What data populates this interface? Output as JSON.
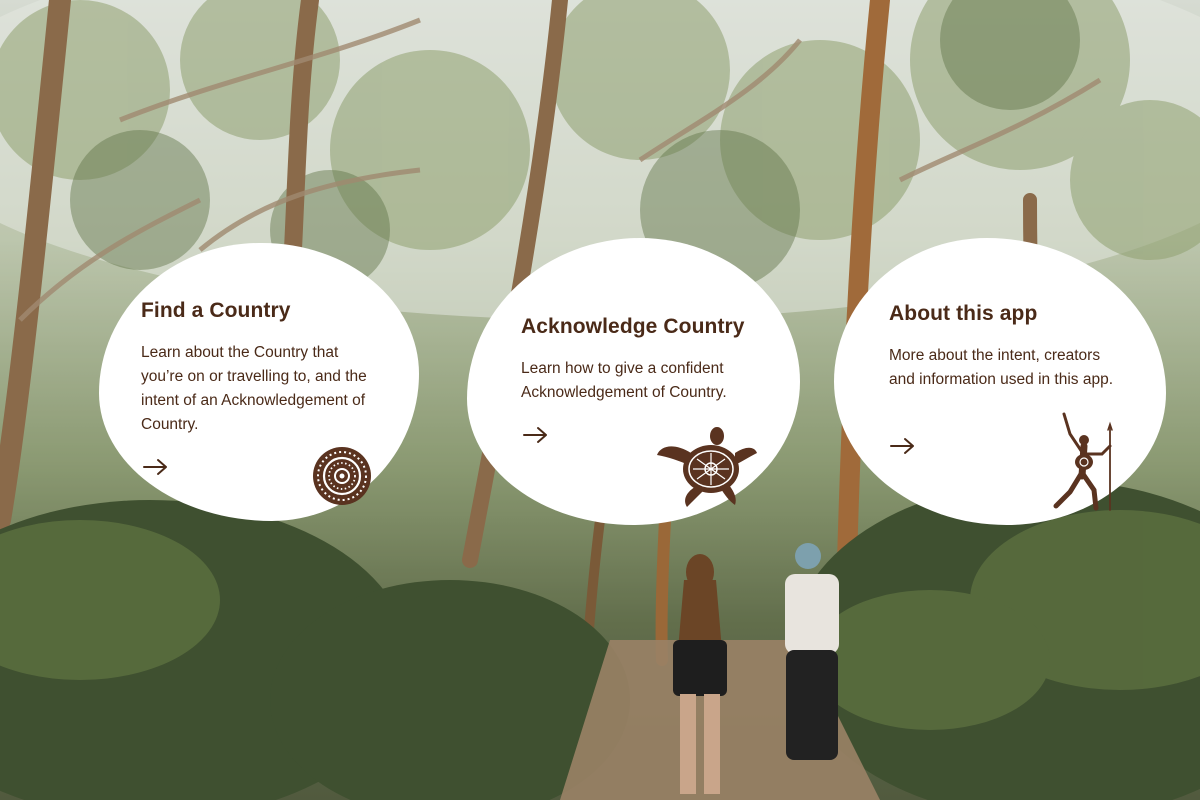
{
  "cards": [
    {
      "id": "find",
      "title": "Find a Country",
      "description": "Learn about the Country that you’re on or travelling to, and the intent of an Acknowledgement of Country.",
      "arrow_icon": "arrow-right-icon",
      "motif_icon": "concentric-circles-icon"
    },
    {
      "id": "ack",
      "title": "Acknowledge Country",
      "description": "Learn how to give a confident Acknowledgement of Country.",
      "arrow_icon": "arrow-right-icon",
      "motif_icon": "turtle-icon"
    },
    {
      "id": "about",
      "title": "About this app",
      "description": "More about the intent, creators and information used in this app.",
      "arrow_icon": "arrow-right-icon",
      "motif_icon": "hunter-figure-icon"
    }
  ],
  "colors": {
    "text": "#4a2a18",
    "card": "#ffffff",
    "motif": "#5a3320"
  },
  "background": "forest-walking-photo"
}
